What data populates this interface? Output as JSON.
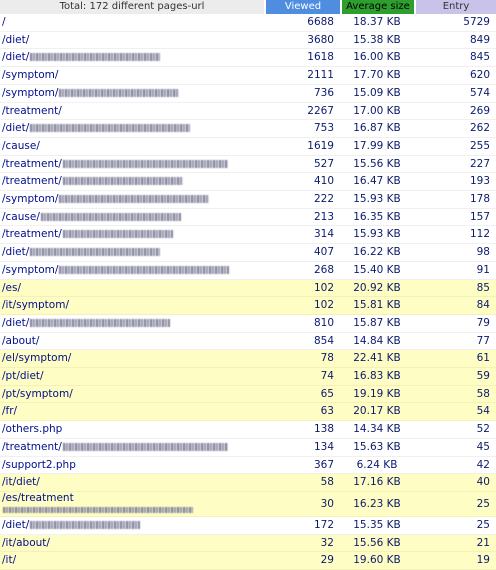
{
  "header": {
    "total": "Total: 172 different pages-url",
    "viewed": "Viewed",
    "avg": "Average size",
    "entry": "Entry"
  },
  "colors": {
    "viewed_header": "#4f8de0",
    "avg_header": "#2e9e2e",
    "entry_header": "#c9c3ea",
    "highlight_row": "#fefdc3"
  },
  "rows": [
    {
      "url": "/",
      "viewed": "6688",
      "avg": "18.37 KB",
      "entry": "5729"
    },
    {
      "url": "/diet/",
      "viewed": "3680",
      "avg": "15.38 KB",
      "entry": "849"
    },
    {
      "url": "/diet/food_tragent_for_acid_reflux.php",
      "viewed": "1618",
      "avg": "16.00 KB",
      "entry": "845",
      "blurred": true
    },
    {
      "url": "/symptom/",
      "viewed": "2111",
      "avg": "17.70 KB",
      "entry": "620"
    },
    {
      "url": "/symptom/",
      "viewed": "736",
      "avg": "15.09 KB",
      "entry": "574",
      "blurred": true
    },
    {
      "url": "/treatment/",
      "viewed": "2267",
      "avg": "17.00 KB",
      "entry": "269"
    },
    {
      "url": "/diet/acid_reflux_recipes.php",
      "viewed": "753",
      "avg": "16.87 KB",
      "entry": "262",
      "blurred": true
    },
    {
      "url": "/cause/",
      "viewed": "1619",
      "avg": "17.99 KB",
      "entry": "255"
    },
    {
      "url": "/treatment/",
      "viewed": "527",
      "avg": "15.56 KB",
      "entry": "227",
      "blurred": true
    },
    {
      "url": "/treatment/",
      "viewed": "410",
      "avg": "16.47 KB",
      "entry": "193",
      "blurred": true
    },
    {
      "url": "/symptom/",
      "viewed": "222",
      "avg": "15.93 KB",
      "entry": "178",
      "blurred": true
    },
    {
      "url": "/cause/",
      "viewed": "213",
      "avg": "16.35 KB",
      "entry": "157",
      "blurred": true
    },
    {
      "url": "/treatment/",
      "viewed": "314",
      "avg": "15.93 KB",
      "entry": "112",
      "blurred": true
    },
    {
      "url": "/diet/",
      "viewed": "407",
      "avg": "16.22 KB",
      "entry": "98",
      "blurred": true
    },
    {
      "url": "/symptom/",
      "viewed": "268",
      "avg": "15.40 KB",
      "entry": "91",
      "blurred": true
    },
    {
      "url": "/es/",
      "viewed": "102",
      "avg": "20.92 KB",
      "entry": "85",
      "highlight": true
    },
    {
      "url": "/it/symptom/",
      "viewed": "102",
      "avg": "15.81 KB",
      "entry": "84",
      "highlight": true
    },
    {
      "url": "/diet/",
      "viewed": "810",
      "avg": "15.87 KB",
      "entry": "79",
      "blurred": true
    },
    {
      "url": "/about/",
      "viewed": "854",
      "avg": "14.84 KB",
      "entry": "77"
    },
    {
      "url": "/el/symptom/",
      "viewed": "78",
      "avg": "22.41 KB",
      "entry": "61",
      "highlight": true
    },
    {
      "url": "/pt/diet/",
      "viewed": "74",
      "avg": "16.83 KB",
      "entry": "59",
      "highlight": true
    },
    {
      "url": "/pt/symptom/",
      "viewed": "65",
      "avg": "19.19 KB",
      "entry": "58",
      "highlight": true
    },
    {
      "url": "/fr/",
      "viewed": "63",
      "avg": "20.17 KB",
      "entry": "54",
      "highlight": true
    },
    {
      "url": "/others.php",
      "viewed": "138",
      "avg": "14.34 KB",
      "entry": "52"
    },
    {
      "url": "/treatment/",
      "viewed": "134",
      "avg": "15.63 KB",
      "entry": "45",
      "blurred": true
    },
    {
      "url": "/support2.php",
      "viewed": "367",
      "avg": "6.24 KB",
      "entry": "42"
    },
    {
      "url": "/it/diet/",
      "viewed": "58",
      "avg": "17.16 KB",
      "entry": "40",
      "highlight": true
    },
    {
      "url": "/es/treatment",
      "viewed": "30",
      "avg": "16.23 KB",
      "entry": "25",
      "highlight": true,
      "twoLine": true
    },
    {
      "url": "/diet/",
      "viewed": "172",
      "avg": "15.35 KB",
      "entry": "25",
      "blurred": true
    },
    {
      "url": "/it/about/",
      "viewed": "32",
      "avg": "15.56 KB",
      "entry": "21",
      "highlight": true
    },
    {
      "url": "/it/",
      "viewed": "29",
      "avg": "19.60 KB",
      "entry": "19",
      "highlight": true
    }
  ]
}
